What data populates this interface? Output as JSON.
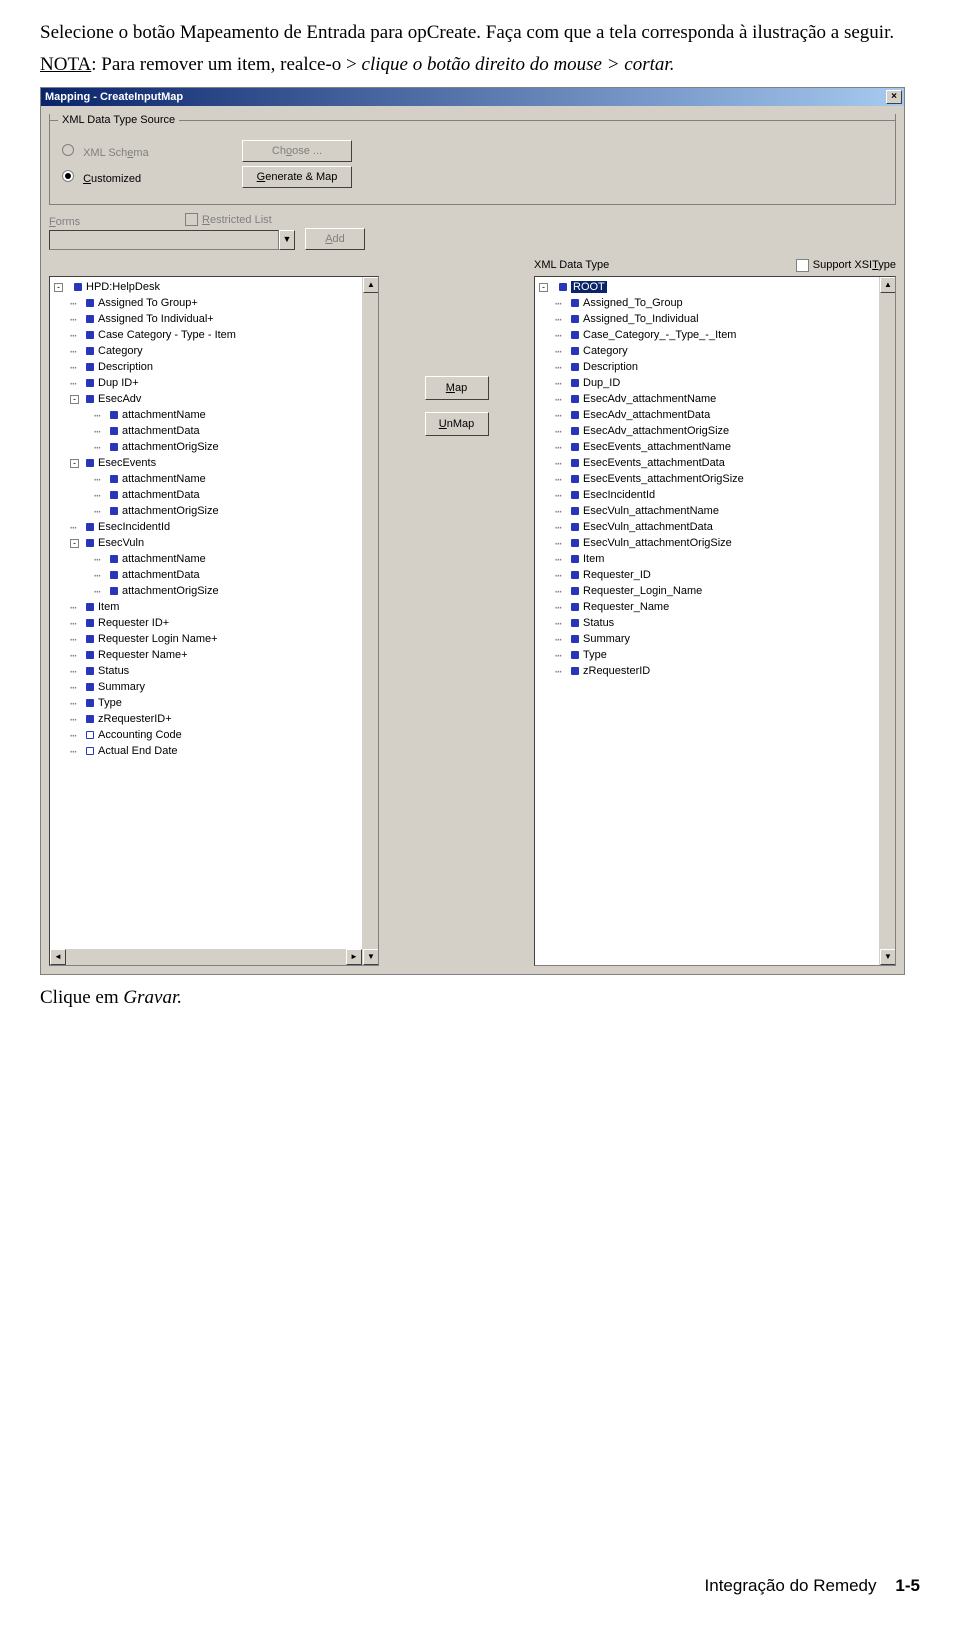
{
  "doc": {
    "line1a": "Selecione o botão Mapeamento de Entrada para opCreate. Faça com que a tela corresponda à ilustração a seguir.",
    "nota_label": "NOTA",
    "nota_rest": ": Para remover um item, realce-o > ",
    "nota_em": "clique o botão direito do mouse > cortar.",
    "after": "Clique em ",
    "after_em": "Gravar.",
    "footer_section": "Integração do Remedy",
    "footer_page": "1-5"
  },
  "dialog": {
    "title": "Mapping - CreateInputMap",
    "group_title": "XML Data Type Source",
    "radio_schema": "XML Schema",
    "radio_customized": "Customized",
    "btn_choose": "Choose ...",
    "btn_generate": "Generate & Map",
    "forms_label": "Forms",
    "restricted_label": "Restricted List",
    "btn_add": "Add",
    "xml_label": "XML Data Type",
    "support_label": "Support XSIType",
    "btn_map": "Map",
    "btn_unmap": "UnMap"
  },
  "left_tree": {
    "root": "HPD:HelpDesk",
    "items": [
      {
        "level": 1,
        "exp": "",
        "label": "Assigned To Group+"
      },
      {
        "level": 1,
        "exp": "",
        "label": "Assigned To Individual+"
      },
      {
        "level": 1,
        "exp": "",
        "label": "Case Category - Type - Item"
      },
      {
        "level": 1,
        "exp": "",
        "label": "Category"
      },
      {
        "level": 1,
        "exp": "",
        "label": "Description"
      },
      {
        "level": 1,
        "exp": "",
        "label": "Dup ID+"
      },
      {
        "level": 1,
        "exp": "-",
        "label": "EsecAdv"
      },
      {
        "level": 2,
        "exp": "",
        "label": "attachmentName"
      },
      {
        "level": 2,
        "exp": "",
        "label": "attachmentData"
      },
      {
        "level": 2,
        "exp": "",
        "label": "attachmentOrigSize"
      },
      {
        "level": 1,
        "exp": "-",
        "label": "EsecEvents"
      },
      {
        "level": 2,
        "exp": "",
        "label": "attachmentName"
      },
      {
        "level": 2,
        "exp": "",
        "label": "attachmentData"
      },
      {
        "level": 2,
        "exp": "",
        "label": "attachmentOrigSize"
      },
      {
        "level": 1,
        "exp": "",
        "label": "EsecIncidentId"
      },
      {
        "level": 1,
        "exp": "-",
        "label": "EsecVuln"
      },
      {
        "level": 2,
        "exp": "",
        "label": "attachmentName"
      },
      {
        "level": 2,
        "exp": "",
        "label": "attachmentData"
      },
      {
        "level": 2,
        "exp": "",
        "label": "attachmentOrigSize"
      },
      {
        "level": 1,
        "exp": "",
        "label": "Item"
      },
      {
        "level": 1,
        "exp": "",
        "label": "Requester ID+"
      },
      {
        "level": 1,
        "exp": "",
        "label": "Requester Login Name+"
      },
      {
        "level": 1,
        "exp": "",
        "label": "Requester Name+"
      },
      {
        "level": 1,
        "exp": "",
        "label": "Status"
      },
      {
        "level": 1,
        "exp": "",
        "label": "Summary"
      },
      {
        "level": 1,
        "exp": "",
        "label": "Type"
      },
      {
        "level": 1,
        "exp": "",
        "label": "zRequesterID+"
      },
      {
        "level": 1,
        "exp": "",
        "hollow": true,
        "label": "Accounting Code"
      },
      {
        "level": 1,
        "exp": "",
        "hollow": true,
        "label": "Actual End Date"
      }
    ]
  },
  "right_tree": {
    "root": "ROOT",
    "items": [
      "Assigned_To_Group",
      "Assigned_To_Individual",
      "Case_Category_-_Type_-_Item",
      "Category",
      "Description",
      "Dup_ID",
      "EsecAdv_attachmentName",
      "EsecAdv_attachmentData",
      "EsecAdv_attachmentOrigSize",
      "EsecEvents_attachmentName",
      "EsecEvents_attachmentData",
      "EsecEvents_attachmentOrigSize",
      "EsecIncidentId",
      "EsecVuln_attachmentName",
      "EsecVuln_attachmentData",
      "EsecVuln_attachmentOrigSize",
      "Item",
      "Requester_ID",
      "Requester_Login_Name",
      "Requester_Name",
      "Status",
      "Summary",
      "Type",
      "zRequesterID"
    ]
  }
}
